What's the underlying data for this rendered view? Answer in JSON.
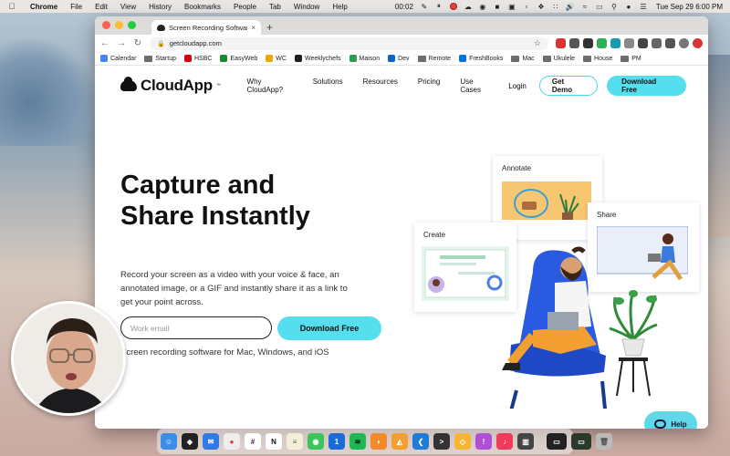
{
  "menubar": {
    "app_name": "Chrome",
    "items": [
      "File",
      "Edit",
      "View",
      "History",
      "Bookmarks",
      "People",
      "Tab",
      "Window",
      "Help"
    ],
    "timer": "00:02",
    "clock": "Tue Sep 29  6:00 PM"
  },
  "browser": {
    "tab_title": "Screen Recording Software for",
    "tab_close": "×",
    "new_tab": "+",
    "url": "getcloudapp.com",
    "bookmarks": [
      {
        "label": "Calendar",
        "color": "#4285f4"
      },
      {
        "label": "Startup",
        "color": "#6d6d6d"
      },
      {
        "label": "HSBC",
        "color": "#db0011"
      },
      {
        "label": "EasyWeb",
        "color": "#1a8a2e"
      },
      {
        "label": "WC",
        "color": "#f0a500"
      },
      {
        "label": "Weeklychefs",
        "color": "#222222"
      },
      {
        "label": "Maison",
        "color": "#2e9e4a"
      },
      {
        "label": "Dev",
        "color": "#0a66c2"
      },
      {
        "label": "Remote",
        "color": "#6d6d6d"
      },
      {
        "label": "FreshBooks",
        "color": "#0075dd"
      },
      {
        "label": "Mac",
        "color": "#6d6d6d"
      },
      {
        "label": "Ukulele",
        "color": "#6d6d6d"
      },
      {
        "label": "House",
        "color": "#6d6d6d"
      },
      {
        "label": "PM",
        "color": "#6d6d6d"
      }
    ]
  },
  "site": {
    "logo": "CloudApp",
    "logo_tm": "™",
    "nav": [
      "Why CloudApp?",
      "Solutions",
      "Resources",
      "Pricing",
      "Use Cases"
    ],
    "login": "Login",
    "get_demo": "Get Demo",
    "download_top": "Download Free",
    "hero_title": "Capture and Share Instantly",
    "hero_sub": "Record your screen as a video with your voice & face, an annotated image, or a GIF and instantly share it as a link to get your point across.",
    "email_placeholder": "Work email",
    "download_main": "Download Free",
    "hero_foot": "Screen recording software for Mac, Windows, and iOS",
    "card_annotate": "Annotate",
    "card_share": "Share",
    "card_create": "Create",
    "help": "Help"
  },
  "colors": {
    "accent": "#55dfee",
    "text": "#111111"
  }
}
